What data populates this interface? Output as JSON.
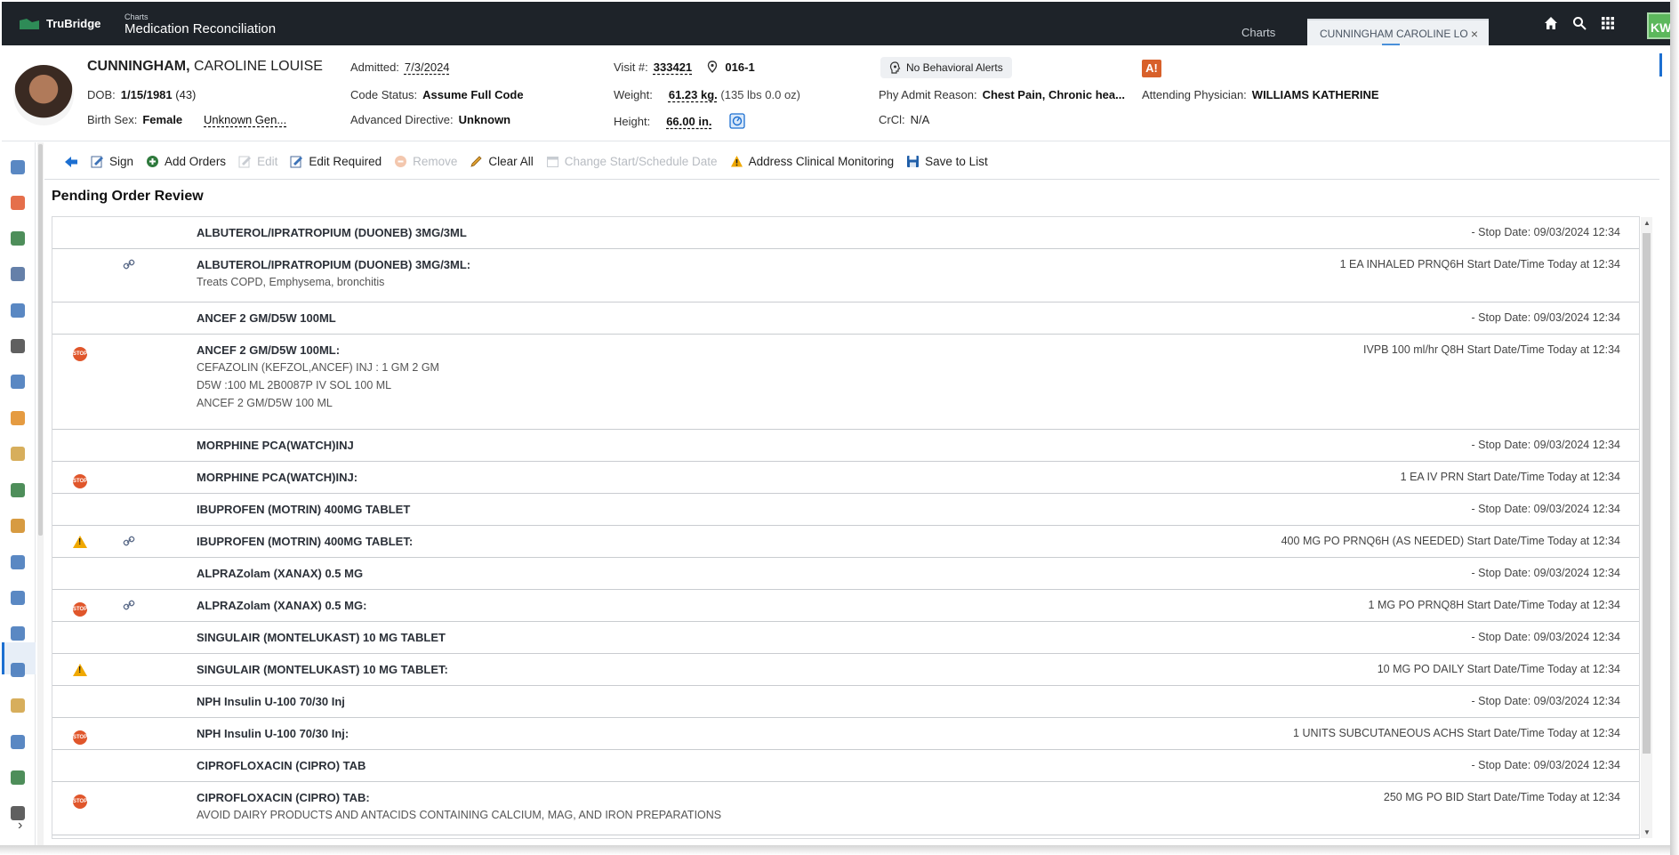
{
  "topbar": {
    "brand": "TruBridge",
    "app_small": "Charts",
    "app_title": "Medication Reconciliation",
    "tab_charts": "Charts",
    "tab_patient": "CUNNINGHAM CAROLINE LO",
    "tab_close": "×",
    "user_initials": "KW",
    "icons": [
      "home-icon",
      "search-icon",
      "apps-grid-icon"
    ]
  },
  "patient": {
    "last": "CUNNINGHAM,",
    "first": " CAROLINE LOUISE",
    "dob_label": "DOB:",
    "dob": "1/15/1981",
    "age": "(43)",
    "sex_label": "Birth Sex:",
    "sex": "Female",
    "gender": "Unknown Gen...",
    "admitted_label": "Admitted:",
    "admitted": "7/3/2024",
    "code_label": "Code Status:",
    "code": "Assume Full Code",
    "adv_label": "Advanced Directive:",
    "adv": "Unknown",
    "visit_label": "Visit #:",
    "visit": "333421",
    "room": "016-1",
    "weight_label": "Weight:",
    "weight": "61.23 kg.",
    "weight_alt": "(135 lbs 0.0 oz)",
    "height_label": "Height:",
    "height": "66.00 in.",
    "behavioral": "No Behavioral Alerts",
    "reason_label": "Phy Admit Reason:",
    "reason": "Chest Pain, Chronic hea...",
    "crcl_label": "CrCl:",
    "crcl": "N/A",
    "attending_label": "Attending Physician:",
    "attending": "WILLIAMS KATHERINE",
    "alert_badge": "A!"
  },
  "toolbar": {
    "sign": "Sign",
    "add_orders": "Add Orders",
    "edit": "Edit",
    "edit_required": "Edit Required",
    "remove": "Remove",
    "clear_all": "Clear All",
    "change_start": "Change Start/Schedule Date",
    "address_monitoring": "Address Clinical Monitoring",
    "save_to_list": "Save to List"
  },
  "section_title": "Pending Order Review",
  "stop_badge": "STOP",
  "colors": {
    "accent": "#1c6fd1",
    "stop": "#e0562b",
    "caution": "#f0a800",
    "topbar": "#1e2329"
  },
  "orders": [
    {
      "name": "ALBUTEROL/IPRATROPIUM (DUONEB) 3MG/3ML",
      "detail": "- Stop Date: 09/03/2024 12:34",
      "subs": []
    },
    {
      "name": "ALBUTEROL/IPRATROPIUM (DUONEB) 3MG/3ML:",
      "detail": "1 EA INHALED PRNQ6H Start Date/Time Today at 12:34",
      "subs": [
        "Treats COPD, Emphysema, bronchitis"
      ],
      "icon2": "link"
    },
    {
      "name": "ANCEF 2 GM/D5W 100ML",
      "detail": "- Stop Date: 09/03/2024 12:34",
      "subs": []
    },
    {
      "name": "ANCEF 2 GM/D5W 100ML:",
      "detail": "IVPB 100 ml/hr Q8H Start Date/Time Today at 12:34",
      "subs": [
        "CEFAZOLIN (KEFZOL,ANCEF) INJ : 1 GM 2 GM",
        "D5W :100 ML 2B0087P IV SOL 100 ML",
        "ANCEF 2 GM/D5W 100 ML"
      ],
      "icon1": "stop"
    },
    {
      "name": "MORPHINE PCA(WATCH)INJ",
      "detail": "- Stop Date: 09/03/2024 12:34",
      "subs": []
    },
    {
      "name": "MORPHINE PCA(WATCH)INJ:",
      "detail": "1 EA IV PRN Start Date/Time Today at 12:34",
      "subs": [],
      "icon1": "stop"
    },
    {
      "name": "IBUPROFEN (MOTRIN) 400MG TABLET",
      "detail": "- Stop Date: 09/03/2024 12:34",
      "subs": []
    },
    {
      "name": "IBUPROFEN (MOTRIN) 400MG TABLET:",
      "detail": "400 MG PO PRNQ6H (AS NEEDED) Start Date/Time Today at 12:34",
      "subs": [],
      "icon1": "caution",
      "icon2": "link"
    },
    {
      "name": "ALPRAZolam (XANAX) 0.5 MG",
      "detail": "- Stop Date: 09/03/2024 12:34",
      "subs": []
    },
    {
      "name": "ALPRAZolam (XANAX) 0.5 MG:",
      "detail": "1 MG PO PRNQ8H Start Date/Time Today at 12:34",
      "subs": [],
      "icon1": "stop",
      "icon2": "link"
    },
    {
      "name": "SINGULAIR (MONTELUKAST) 10 MG TABLET",
      "detail": "- Stop Date: 09/03/2024 12:34",
      "subs": []
    },
    {
      "name": "SINGULAIR (MONTELUKAST) 10 MG TABLET:",
      "detail": "10 MG PO DAILY Start Date/Time Today at 12:34",
      "subs": [],
      "icon1": "caution"
    },
    {
      "name": "NPH Insulin U-100 70/30 Inj",
      "detail": "- Stop Date: 09/03/2024 12:34",
      "subs": []
    },
    {
      "name": "NPH Insulin U-100 70/30 Inj:",
      "detail": "1 UNITS SUBCUTANEOUS ACHS Start Date/Time Today at 12:34",
      "subs": [],
      "icon1": "stop"
    },
    {
      "name": "CIPROFLOXACIN (CIPRO) TAB",
      "detail": "- Stop Date: 09/03/2024 12:34",
      "subs": []
    },
    {
      "name": "CIPROFLOXACIN (CIPRO) TAB:",
      "detail": "250 MG PO BID Start Date/Time Today at 12:34",
      "subs": [
        "AVOID DAIRY PRODUCTS AND ANTACIDS CONTAINING CALCIUM, MAG, AND IRON PREPARATIONS"
      ],
      "icon1": "stop"
    }
  ]
}
